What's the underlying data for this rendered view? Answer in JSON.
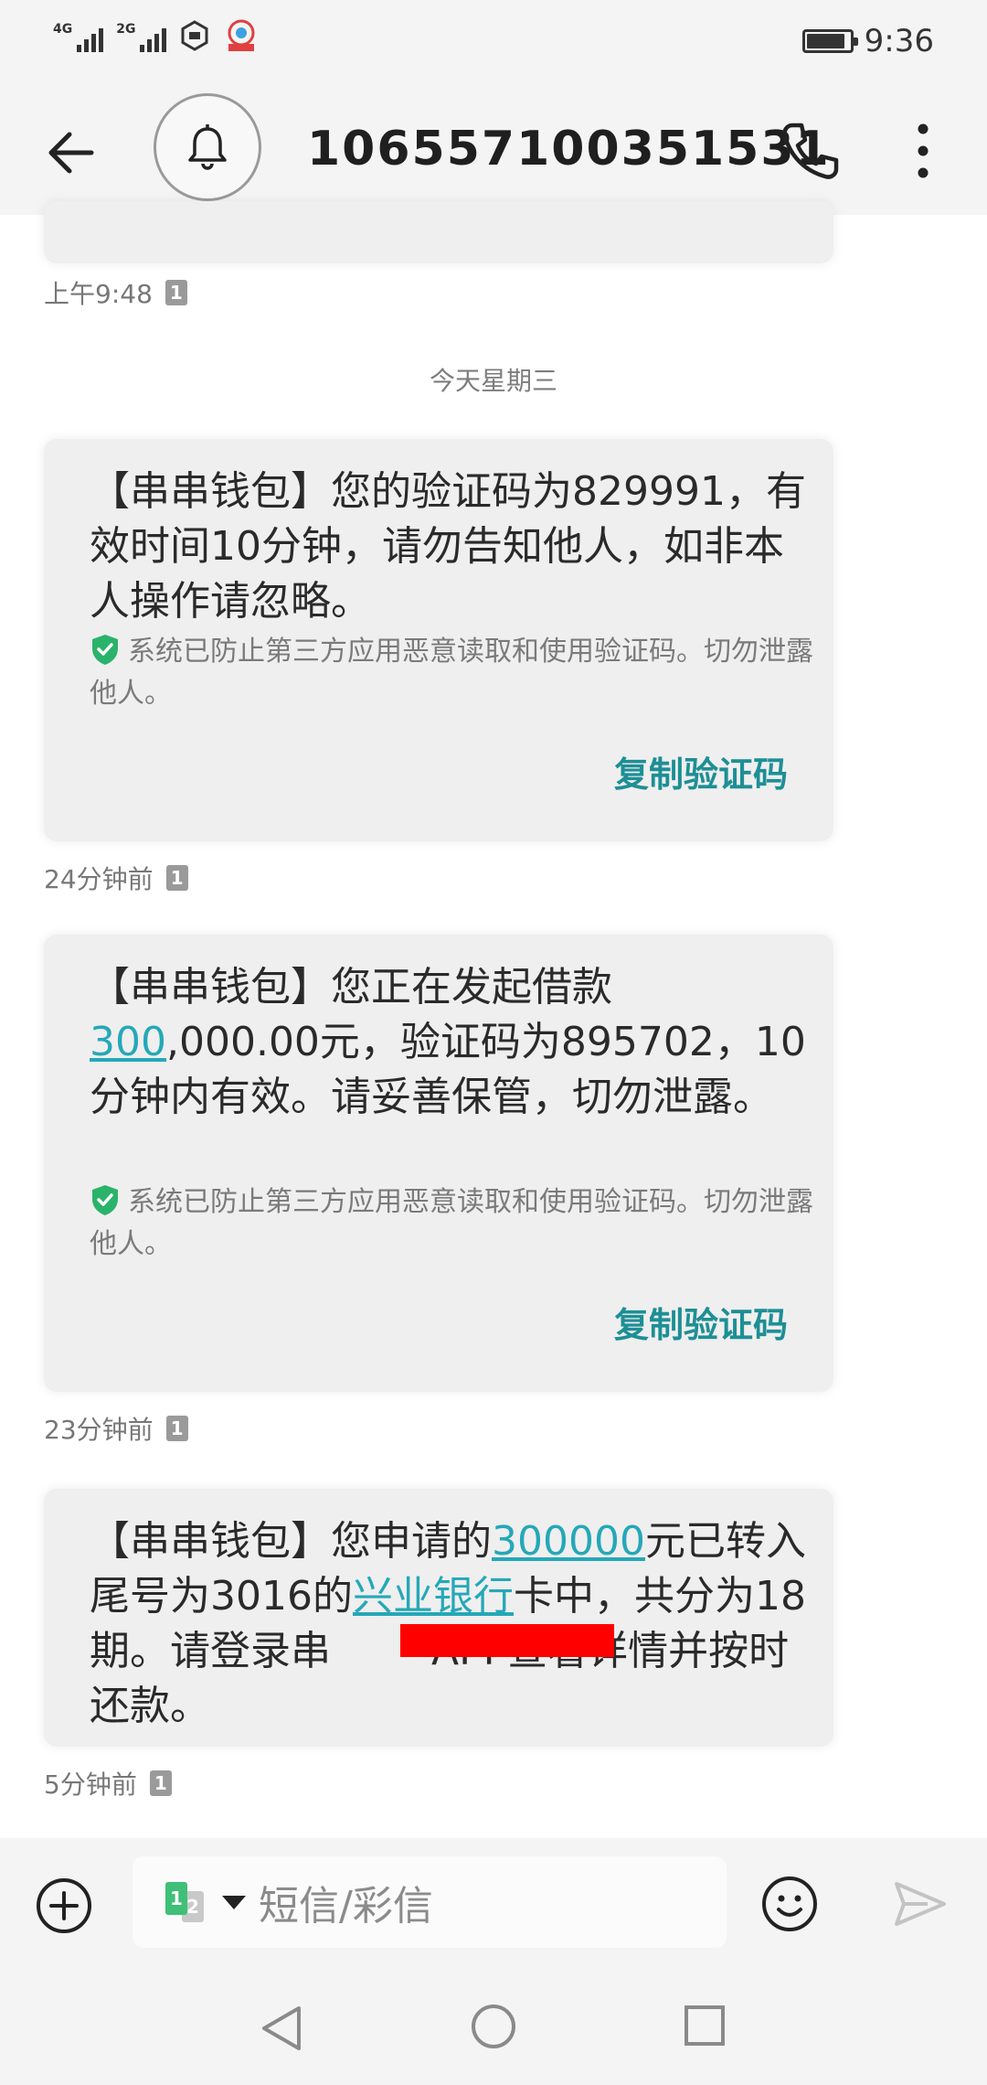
{
  "status_bar": {
    "network_1": "4G",
    "network_2": "2G",
    "time": "9:36",
    "battery_level_percent": 90
  },
  "header": {
    "phone_number": "106557100351531",
    "icons": [
      "back-arrow-icon",
      "bell-icon",
      "phone-icon",
      "more-vertical-icon"
    ]
  },
  "messages": [
    {
      "timestamp": "上午9:48",
      "sim_label": "1"
    },
    {
      "date_divider": "今天星期三"
    },
    {
      "body": "【串串钱包】您的验证码为829991，有效时间10分钟，请勿告知他人，如非本人操作请忽略。",
      "notice": "系统已防止第三方应用恶意读取和使用验证码。切勿泄露他人。",
      "copy_label": "复制验证码",
      "timestamp": "24分钟前",
      "sim_label": "1"
    },
    {
      "body_prefix": "【串串钱包】您正在发起借款",
      "body_link": "300",
      "body_suffix": ",000.00元，验证码为895702，10分钟内有效。请妥善保管，切勿泄露。",
      "notice": "系统已防止第三方应用恶意读取和使用验证码。切勿泄露他人。",
      "copy_label": "复制验证码",
      "timestamp": "23分钟前",
      "sim_label": "1"
    },
    {
      "body_part1": "【串串钱包】您申请的",
      "body_link1": "300000",
      "body_part2": "元已转入尾号为3016的",
      "body_link2": "兴业银行",
      "body_part3": "卡中，共分为18期。请登录串",
      "body_part4": "APP查看详情并按时还款。",
      "timestamp": "5分钟前",
      "sim_label": "1"
    }
  ],
  "composer": {
    "placeholder": "短信/彩信",
    "sim_primary": "1",
    "sim_secondary": "2"
  },
  "colors": {
    "link": "#25a8b8",
    "copy_button": "#1d8f95",
    "shield": "#2ab36a",
    "redaction": "#ff0000"
  }
}
